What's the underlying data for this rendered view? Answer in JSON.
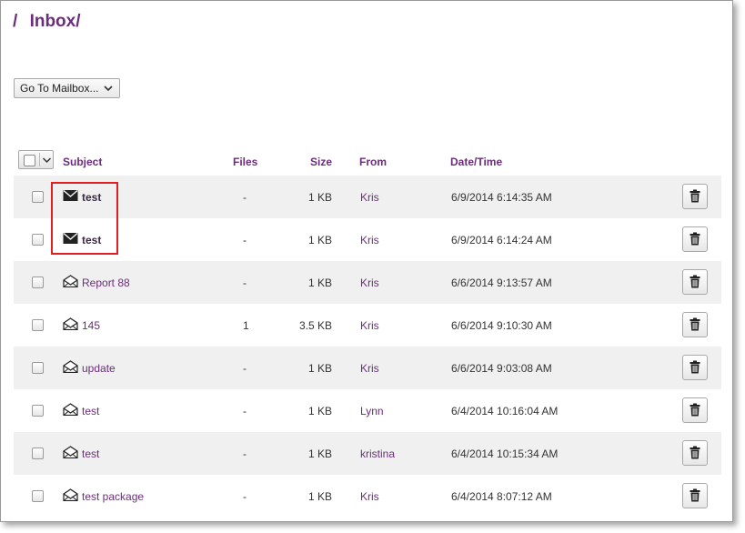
{
  "breadcrumb": {
    "separator": "/",
    "folder": "Inbox/"
  },
  "goto_mailbox": {
    "label": "Go To Mailbox...",
    "icon": "chevron-down-icon"
  },
  "columns": {
    "subject": "Subject",
    "files": "Files",
    "size": "Size",
    "from": "From",
    "datetime": "Date/Time"
  },
  "icons": {
    "unread": "envelope-closed-icon",
    "read": "envelope-open-icon",
    "delete": "trash-icon",
    "select_all": "chevron-down-icon"
  },
  "colors": {
    "accent": "#6b2d7b",
    "highlight": "#e02020"
  },
  "messages": [
    {
      "subject": "test",
      "files": "-",
      "size": "1 KB",
      "from": "Kris",
      "datetime": "6/9/2014 6:14:35 AM",
      "unread": true
    },
    {
      "subject": "test",
      "files": "-",
      "size": "1 KB",
      "from": "Kris",
      "datetime": "6/9/2014 6:14:24 AM",
      "unread": true
    },
    {
      "subject": "Report 88",
      "files": "-",
      "size": "1 KB",
      "from": "Kris",
      "datetime": "6/6/2014 9:13:57 AM",
      "unread": false
    },
    {
      "subject": "145",
      "files": "1",
      "size": "3.5 KB",
      "from": "Kris",
      "datetime": "6/6/2014 9:10:30 AM",
      "unread": false
    },
    {
      "subject": "update",
      "files": "-",
      "size": "1 KB",
      "from": "Kris",
      "datetime": "6/6/2014 9:03:08 AM",
      "unread": false
    },
    {
      "subject": "test",
      "files": "-",
      "size": "1 KB",
      "from": "Lynn",
      "datetime": "6/4/2014 10:16:04 AM",
      "unread": false
    },
    {
      "subject": "test",
      "files": "-",
      "size": "1 KB",
      "from": "kristina",
      "datetime": "6/4/2014 10:15:34 AM",
      "unread": false
    },
    {
      "subject": "test package",
      "files": "-",
      "size": "1 KB",
      "from": "Kris",
      "datetime": "6/4/2014 8:07:12 AM",
      "unread": false
    }
  ]
}
